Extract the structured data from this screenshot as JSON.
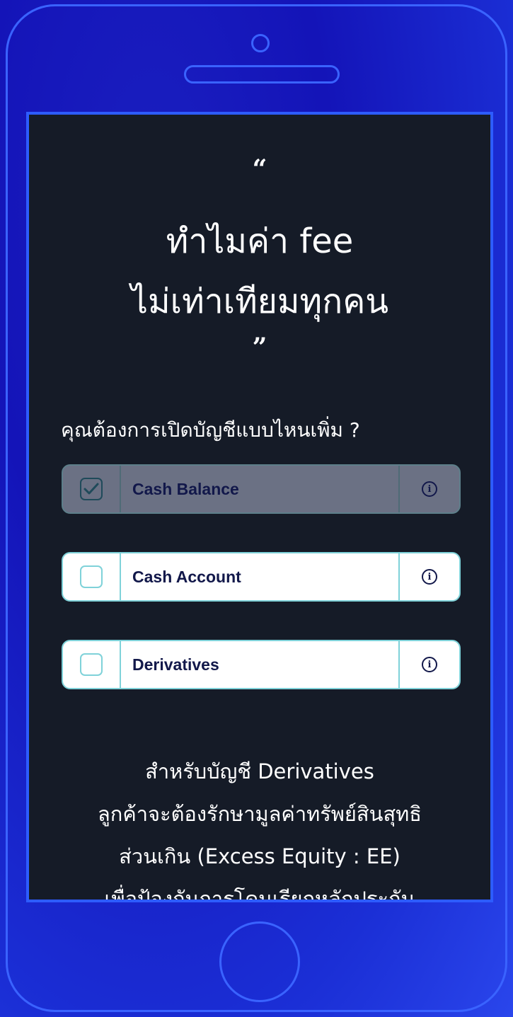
{
  "screen": {
    "quote_open": "“",
    "quote_close": "”",
    "headline_line1": "ทำไมค่า fee",
    "headline_line2": "ไม่เท่าเทียมทุกคน",
    "question": "คุณต้องการเปิดบัญชีแบบไหนเพิ่ม ?",
    "options": [
      {
        "label": "Cash Balance",
        "checked": true
      },
      {
        "label": "Cash Account",
        "checked": false
      },
      {
        "label": "Derivatives",
        "checked": false
      }
    ],
    "info_glyph": "i",
    "note_lines": [
      "สำหรับบัญชี Derivatives",
      "ลูกค้าจะต้องรักษามูลค่าทรัพย์สินสุทธิ",
      "ส่วนเกิน (Excess Equity : EE)",
      "เพื่อป้องกันการโดนเรียกหลักประกัน"
    ]
  },
  "colors": {
    "accent": "#2d5cff",
    "screen_bg": "#151b27",
    "option_border": "#7fd2d9",
    "option_text": "#12184a",
    "selected_bg": "#6b7184"
  },
  "icons": {
    "check": "checkmark-icon",
    "info": "info-icon"
  }
}
